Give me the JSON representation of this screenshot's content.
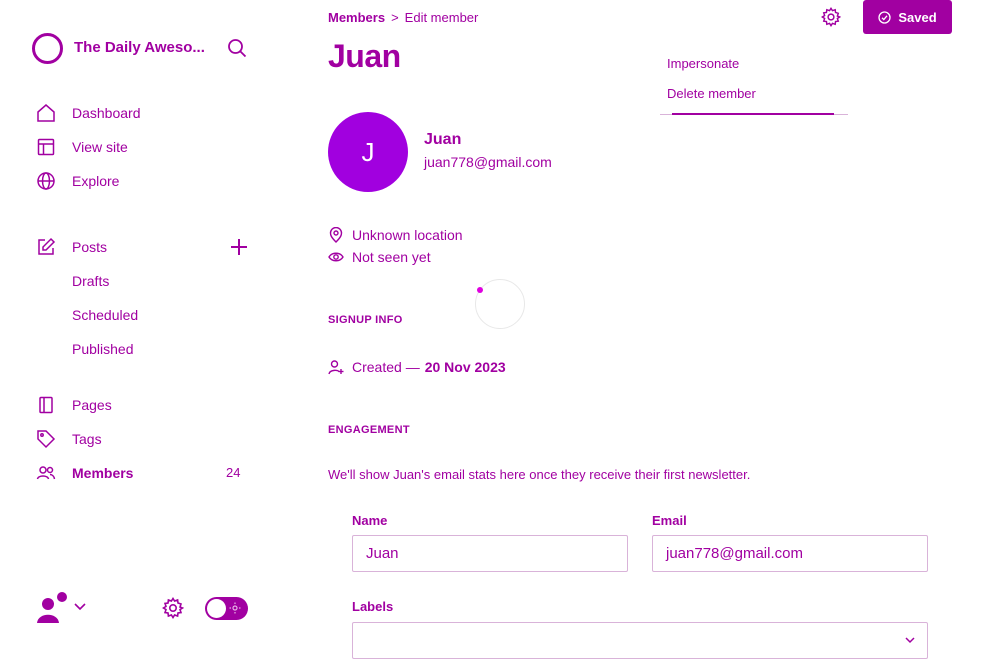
{
  "brand": {
    "name": "The Daily Aweso..."
  },
  "sidebar": {
    "items": [
      {
        "label": "Dashboard",
        "icon": "home-icon"
      },
      {
        "label": "View site",
        "icon": "layout-icon"
      },
      {
        "label": "Explore",
        "icon": "globe-icon"
      }
    ],
    "posts": {
      "label": "Posts",
      "icon": "edit-icon",
      "add_icon": "plus-icon"
    },
    "post_subitems": [
      "Drafts",
      "Scheduled",
      "Published"
    ],
    "more_items": [
      {
        "label": "Pages",
        "icon": "pages-icon"
      },
      {
        "label": "Tags",
        "icon": "tag-icon"
      },
      {
        "label": "Members",
        "icon": "members-icon",
        "count": "24"
      }
    ]
  },
  "breadcrumb": {
    "parent": "Members",
    "separator": ">",
    "current": "Edit member"
  },
  "header": {
    "title": "Juan",
    "saved_label": "Saved"
  },
  "menu": {
    "items": [
      "Impersonate",
      "Delete member"
    ]
  },
  "profile": {
    "initial": "J",
    "name": "Juan",
    "email": "juan778@gmail.com",
    "location": "Unknown location",
    "seen": "Not seen yet"
  },
  "signup": {
    "heading": "SIGNUP INFO",
    "created_prefix": "Created —",
    "created_date": "20 Nov 2023"
  },
  "engagement": {
    "heading": "ENGAGEMENT",
    "text": "We'll show Juan's email stats here once they receive their first newsletter."
  },
  "form": {
    "name_label": "Name",
    "name_value": "Juan",
    "email_label": "Email",
    "email_value": "juan778@gmail.com",
    "labels_label": "Labels",
    "labels_value": ""
  },
  "colors": {
    "accent": "#a100a1",
    "avatar": "#a100df"
  }
}
